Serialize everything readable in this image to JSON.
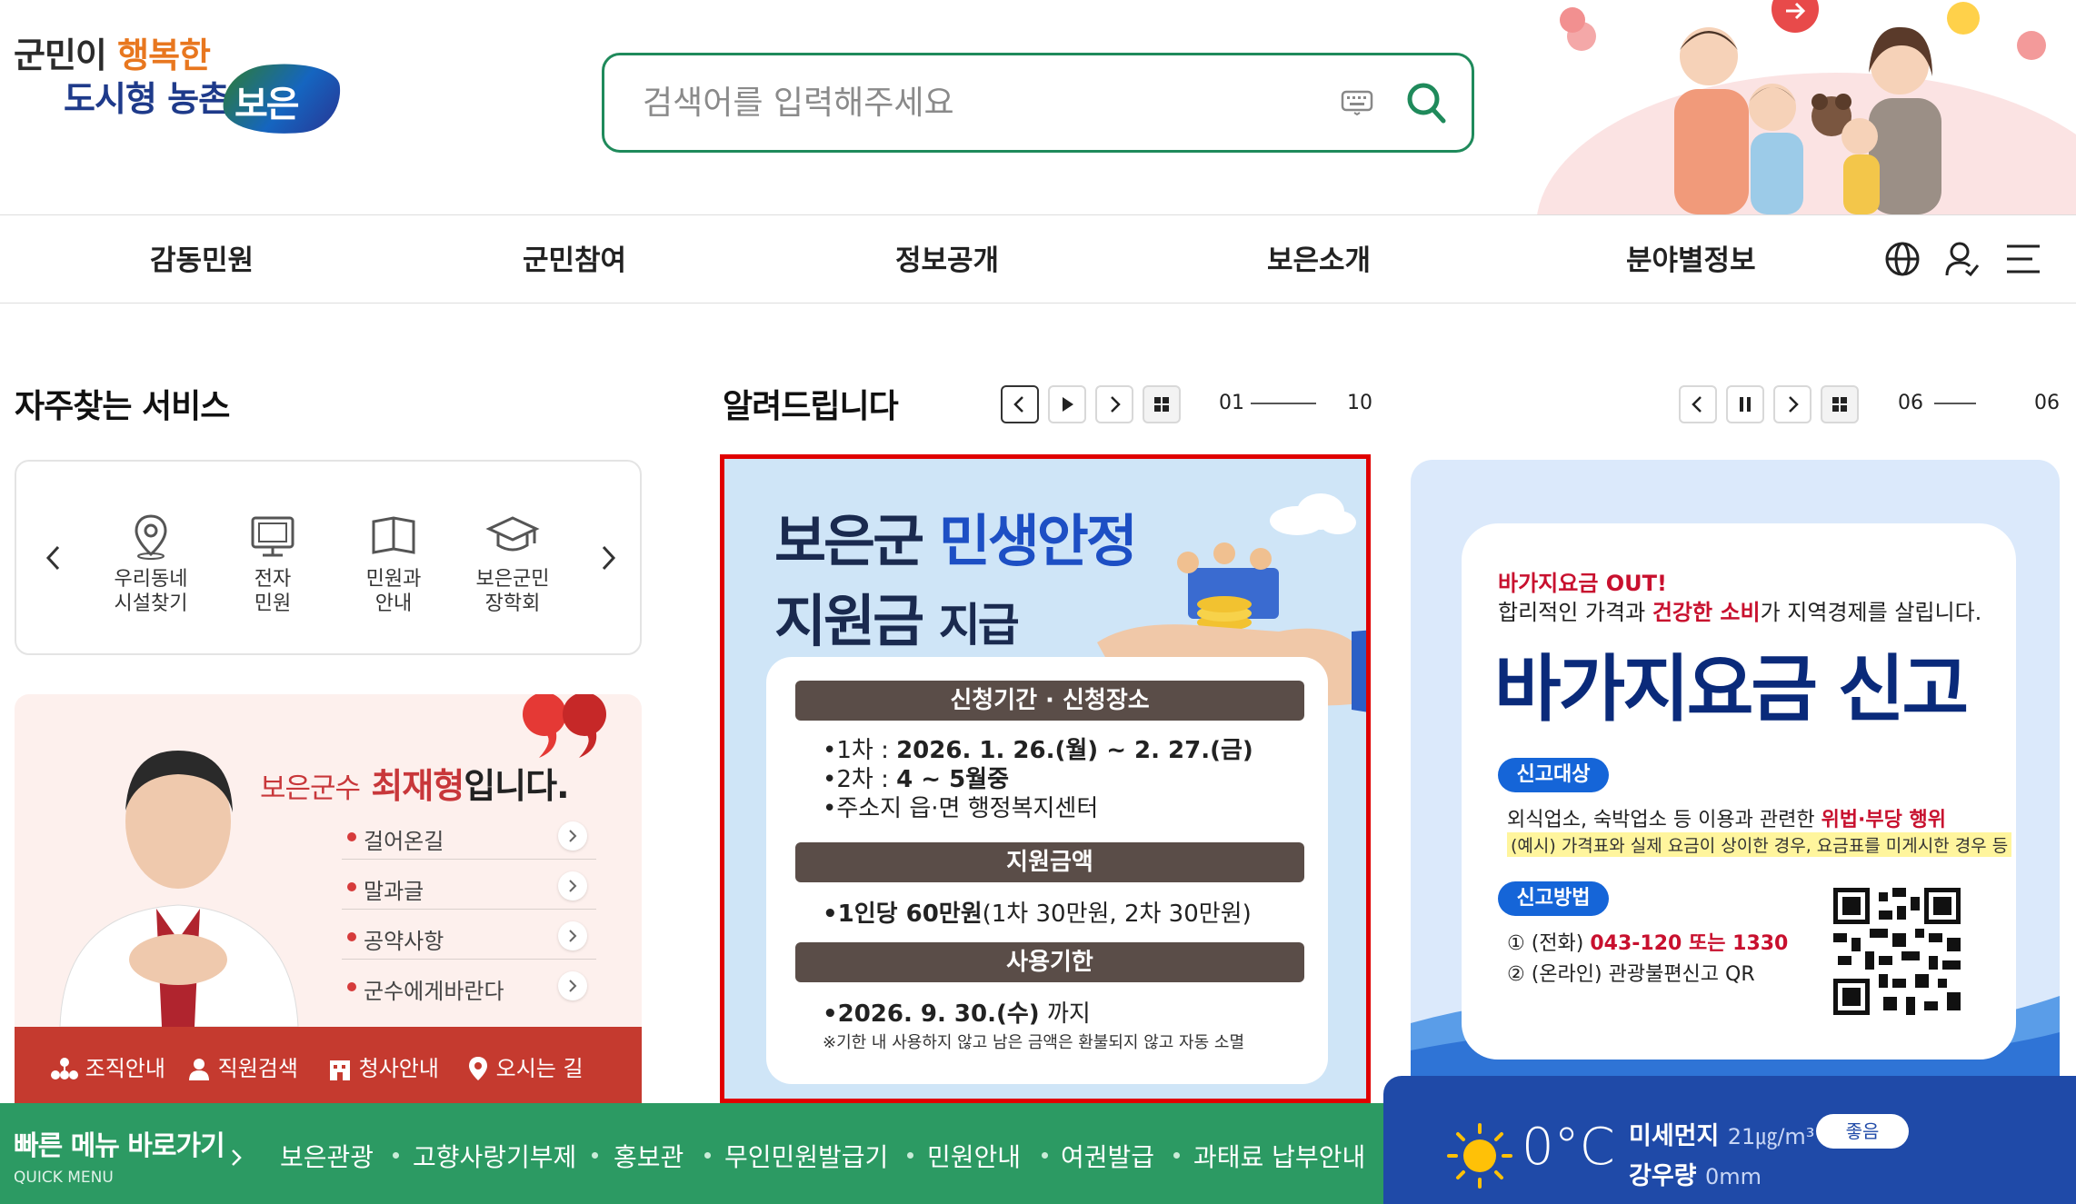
{
  "logo": {
    "line1_prefix": "군민이",
    "line1_accent": "행복한",
    "line2": "도시형 농촌",
    "brand": "보은"
  },
  "search": {
    "placeholder": "검색어를 입력해주세요"
  },
  "nav": {
    "items": [
      "감동민원",
      "군민참여",
      "정보공개",
      "보은소개",
      "분야별정보"
    ]
  },
  "quick_services": {
    "title": "자주찾는 서비스",
    "items": [
      {
        "line1": "우리동네",
        "line2": "시설찾기",
        "icon": "map-pin-icon"
      },
      {
        "line1": "전자",
        "line2": "민원",
        "icon": "monitor-icon"
      },
      {
        "line1": "민원과",
        "line2": "안내",
        "icon": "book-icon"
      },
      {
        "line1": "보은군민",
        "line2": "장학회",
        "icon": "graduation-cap-icon"
      }
    ]
  },
  "governor": {
    "title_prefix": "보은군수",
    "title_name": "최재형",
    "title_suffix": "입니다.",
    "links": [
      "걸어온길",
      "말과글",
      "공약사항",
      "군수에게바란다"
    ],
    "bar": [
      "조직안내",
      "직원검색",
      "청사안내",
      "오시는 길"
    ]
  },
  "notice": {
    "title": "알려드립니다",
    "pager_current": "01",
    "pager_total": "10",
    "banner": {
      "headline_a": "보은군",
      "headline_b": "민생안정",
      "headline_c": "지원금",
      "headline_d": "지급",
      "section1": "신청기간 · 신청장소",
      "line1_label": "•1차 : ",
      "line1_value": "2026. 1. 26.(월) ~ 2. 27.(금)",
      "line2_label": "•2차 : ",
      "line2_value": "4 ~ 5월중",
      "line3": "•주소지 읍·면 행정복지센터",
      "section2": "지원금액",
      "line4_bold": "•1인당 60만원",
      "line4_rest": "(1차 30만원, 2차 30만원)",
      "section3": "사용기한",
      "line5_bold": "•2026. 9. 30.(수)",
      "line5_rest": " 까지",
      "note": "※기한 내 사용하지 않고 남은 금액은 환불되지 않고 자동 소멸"
    }
  },
  "popup": {
    "pager_current": "06",
    "pager_total": "06",
    "banner": {
      "t1": "바가지요금 OUT!",
      "t2_a": "합리적인 가격과 ",
      "t2_b": "건강한 소비",
      "t2_c": "가 지역경제를 살립니다.",
      "headline": "바가지요금 신고",
      "tag1": "신고대상",
      "target_a": "외식업소, 숙박업소 등 이용과 관련한 ",
      "target_b": "위법·부당 행위",
      "example": "(예시) 가격표와 실제 요금이 상이한 경우, 요금표를 미게시한 경우 등",
      "tag2": "신고방법",
      "method1_a": "① (전화) ",
      "method1_b": "043-120 또는 1330",
      "method2": "② (온라인) 관광불편신고 QR"
    }
  },
  "quick_menu": {
    "title": "빠른 메뉴 바로가기",
    "subtitle": "QUICK MENU",
    "items": [
      "보은관광",
      "고향사랑기부제",
      "홍보관",
      "무인민원발급기",
      "민원안내",
      "여권발급",
      "과태료 납부안내"
    ]
  },
  "weather": {
    "temperature": "0°C",
    "dust_label": "미세먼지",
    "dust_value": "21㎍/m³",
    "dust_status": "좋음",
    "rain_label": "강우량",
    "rain_value": "0mm"
  },
  "colors": {
    "brand_green": "#2c9a63",
    "search_border": "#1f8a5b",
    "highlight_red": "#e00000",
    "governor_bar": "#c53a2f",
    "weather_blue": "#1f4aa8"
  }
}
